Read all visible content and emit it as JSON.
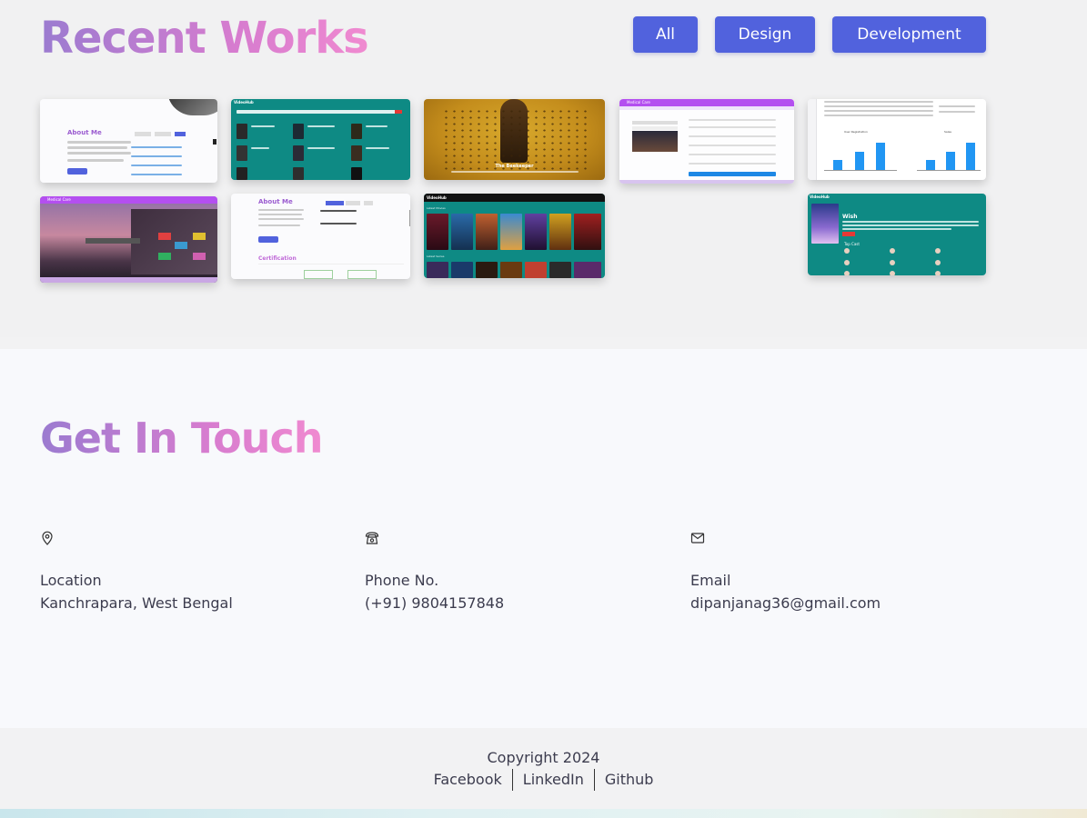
{
  "works": {
    "title": "Recent Works",
    "filters": [
      "All",
      "Design",
      "Development"
    ],
    "thumbs": {
      "t1": {
        "heading": "About Me",
        "tabs": [
          "Experience",
          "Education",
          "Skills"
        ],
        "button": "Hire Me"
      },
      "t2": {
        "brand": "VideoHub"
      },
      "t3": {
        "caption": "The Beekeeper"
      },
      "t4": {
        "brand": "Medical Care"
      },
      "t5": {
        "chart1": "User Registration",
        "chart2": "Sales"
      },
      "t6": {
        "brand": "Medical Care"
      },
      "t7": {
        "heading": "About Me",
        "section": "Certification"
      },
      "t8": {
        "brand": "VideoHub",
        "row1": "Latest Movies",
        "row2": "Latest Series"
      },
      "t10": {
        "brand": "VideoHub",
        "title": "Wish",
        "cast": "Top Cast"
      }
    }
  },
  "contact": {
    "title": "Get In Touch",
    "items": [
      {
        "icon": "location-pin-icon",
        "label": "Location",
        "value": "Kanchrapara, West Bengal"
      },
      {
        "icon": "phone-icon",
        "label": "Phone No.",
        "value": "(+91) 9804157848"
      },
      {
        "icon": "mail-icon",
        "label": "Email",
        "value": "dipanjanag36@gmail.com"
      }
    ]
  },
  "footer": {
    "copyright": "Copyright 2024",
    "links": [
      "Facebook",
      "LinkedIn",
      "Github"
    ]
  },
  "colors": {
    "accent": "#5162dd",
    "gradient_start": "#9b7bd0",
    "gradient_end": "#f08ad0",
    "teal": "#0e8a84",
    "purple": "#b44ff0"
  }
}
